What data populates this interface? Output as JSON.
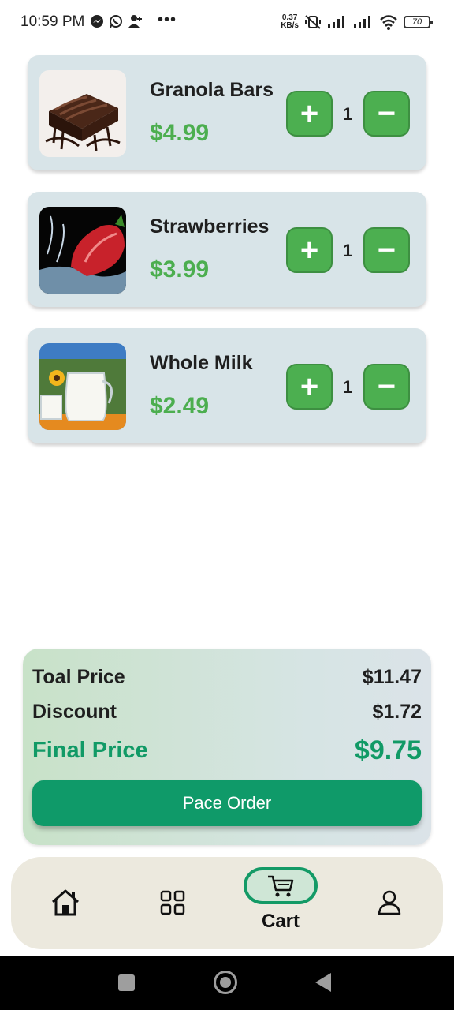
{
  "status_bar": {
    "time": "10:59 PM",
    "speed_value": "0.37",
    "speed_unit": "KB/s",
    "battery": "70",
    "icons": [
      "messenger-icon",
      "whatsapp-icon",
      "person-add-icon",
      "more-dots-icon",
      "vibrate-off-icon",
      "signal-icon",
      "signal-icon",
      "wifi-icon",
      "battery-icon"
    ]
  },
  "cart": {
    "items": [
      {
        "name": "Granola Bars",
        "price": "$4.99",
        "quantity": "1",
        "image": "chocolate-brownie-image"
      },
      {
        "name": "Strawberries",
        "price": "$3.99",
        "quantity": "1",
        "image": "strawberry-splash-image"
      },
      {
        "name": "Whole Milk",
        "price": "$2.49",
        "quantity": "1",
        "image": "milk-jug-image"
      }
    ],
    "plus_symbol": "+",
    "minus_symbol": "−"
  },
  "summary": {
    "total_label": "Toal Price",
    "total_value": "$11.47",
    "discount_label": "Discount",
    "discount_value": "$1.72",
    "final_label": "Final Price",
    "final_value": "$9.75",
    "order_button": "Pace Order"
  },
  "bottom_nav": {
    "items": [
      {
        "icon": "home-icon",
        "label": ""
      },
      {
        "icon": "grid-icon",
        "label": ""
      },
      {
        "icon": "cart-icon",
        "label": "Cart",
        "active": true
      },
      {
        "icon": "profile-icon",
        "label": ""
      }
    ]
  },
  "colors": {
    "accent_green": "#4caf50",
    "final_green": "#0f9a69",
    "card_bg": "#d8e4e8",
    "nav_bg": "#ece9de"
  }
}
